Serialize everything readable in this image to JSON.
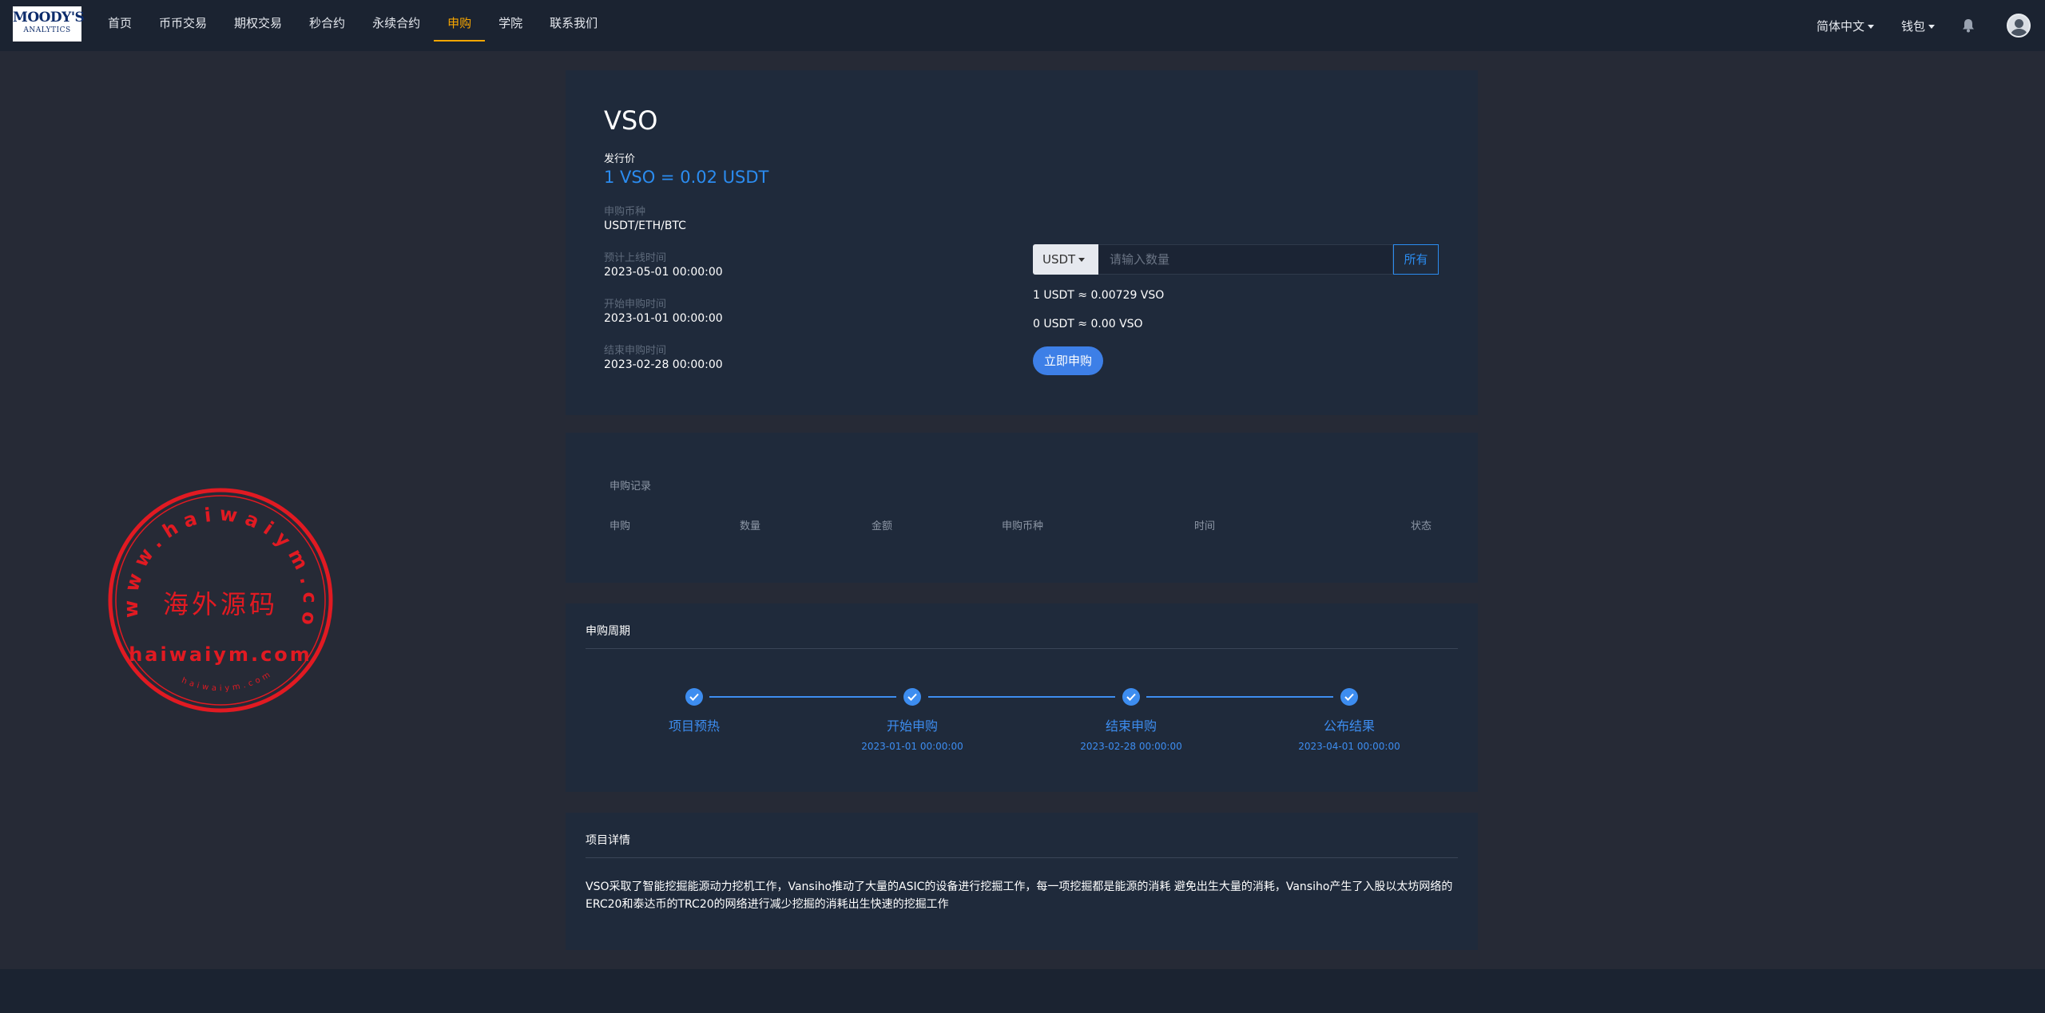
{
  "logo": {
    "line1": "MOODY'S",
    "line2": "ANALYTICS"
  },
  "nav": {
    "items": [
      "首页",
      "币币交易",
      "期权交易",
      "秒合约",
      "永续合约",
      "申购",
      "学院",
      "联系我们"
    ],
    "active_index": 5,
    "language": "简体中文",
    "wallet": "钱包"
  },
  "token": {
    "name": "VSO",
    "issue_price_label": "发行价",
    "issue_price": "1 VSO = 0.02 USDT",
    "currency_label": "申购币种",
    "currency": "USDT/ETH/BTC",
    "listing_label": "预计上线时间",
    "listing_time": "2023-05-01 00:00:00",
    "start_label": "开始申购时间",
    "start_time": "2023-01-01 00:00:00",
    "end_label": "结束申购时间",
    "end_time": "2023-02-28 00:00:00"
  },
  "buy": {
    "currency": "USDT",
    "placeholder": "请输入数量",
    "all_label": "所有",
    "rate": "1 USDT ≈ 0.00729 VSO",
    "estimate": "0 USDT ≈ 0.00 VSO",
    "submit": "立即申购"
  },
  "records": {
    "title": "申购记录",
    "columns": [
      "申购",
      "数量",
      "金额",
      "申购币种",
      "时间",
      "状态"
    ]
  },
  "cycle": {
    "title": "申购周期",
    "steps": [
      {
        "label": "项目预热",
        "date": ""
      },
      {
        "label": "开始申购",
        "date": "2023-01-01 00:00:00"
      },
      {
        "label": "结束申购",
        "date": "2023-02-28 00:00:00"
      },
      {
        "label": "公布结果",
        "date": "2023-04-01 00:00:00"
      }
    ],
    "accent": "#3d8df0"
  },
  "details": {
    "title": "项目详情",
    "text": "VSO采取了智能挖掘能源动力挖机工作，Vansiho推动了大量的ASIC的设备进行挖掘工作，每一项挖掘都是能源的消耗 避免出生大量的消耗，Vansiho产生了入股以太坊网络的ERC20和泰达币的TRC20的网络进行减少挖掘的消耗出生快速的挖掘工作"
  },
  "watermark": {
    "main": "海外源码",
    "url": "haiwaiym.com",
    "ring": "www.haiwaiym.com",
    "small": "haiwaiym.com"
  },
  "colors": {
    "accent": "#2b8cf0",
    "active_nav": "#f7a600",
    "stamp": "#e11a22"
  }
}
